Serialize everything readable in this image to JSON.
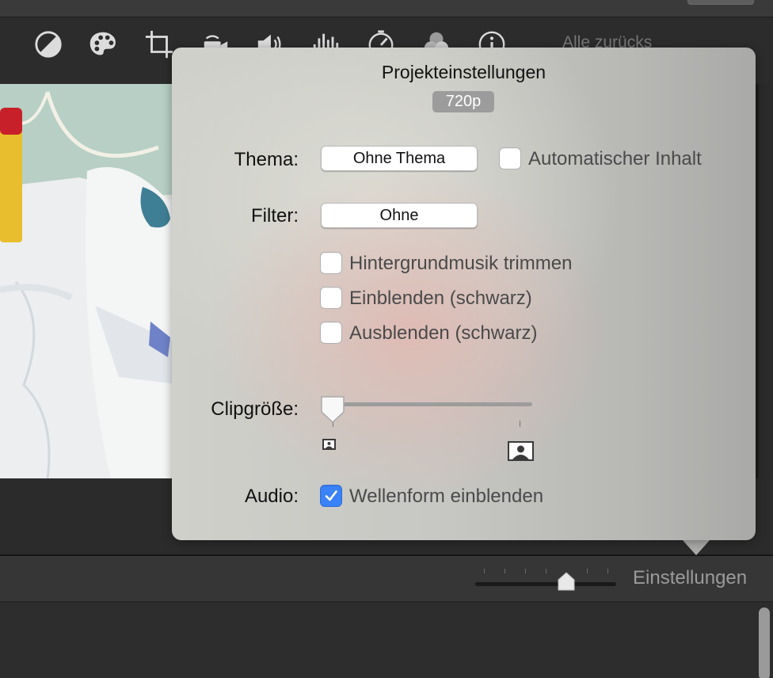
{
  "toolbar": {
    "tools": [
      {
        "icon": "color-balance-icon"
      },
      {
        "icon": "color-palette-icon"
      },
      {
        "icon": "crop-icon"
      },
      {
        "icon": "stabilization-camera-icon"
      },
      {
        "icon": "volume-icon"
      },
      {
        "icon": "equalizer-icon"
      },
      {
        "icon": "speed-gauge-icon"
      },
      {
        "icon": "clip-filter-icon"
      },
      {
        "icon": "info-icon"
      }
    ],
    "reset_label": "Alle zurücks"
  },
  "popover": {
    "title": "Projekteinstellungen",
    "resolution": "720p",
    "theme": {
      "label": "Thema:",
      "value": "Ohne Thema"
    },
    "auto_content": {
      "label": "Automatischer Inhalt",
      "checked": false
    },
    "filter": {
      "label": "Filter:",
      "value": "Ohne"
    },
    "options": [
      {
        "label": "Hintergrundmusik trimmen",
        "checked": false
      },
      {
        "label": "Einblenden (schwarz)",
        "checked": false
      },
      {
        "label": "Ausblenden (schwarz)",
        "checked": false
      }
    ],
    "clip_size": {
      "label": "Clipgröße:",
      "value": 0
    },
    "audio": {
      "label": "Audio:",
      "option_label": "Wellenform einblenden",
      "checked": true
    }
  },
  "timeline_bar": {
    "settings_label": "Einstellungen",
    "zoom_value": 0.57
  },
  "colors": {
    "accent": "#3a82f7",
    "toolbar_bg": "#2c2c2c",
    "popover_bg": "#c8c8c4"
  }
}
